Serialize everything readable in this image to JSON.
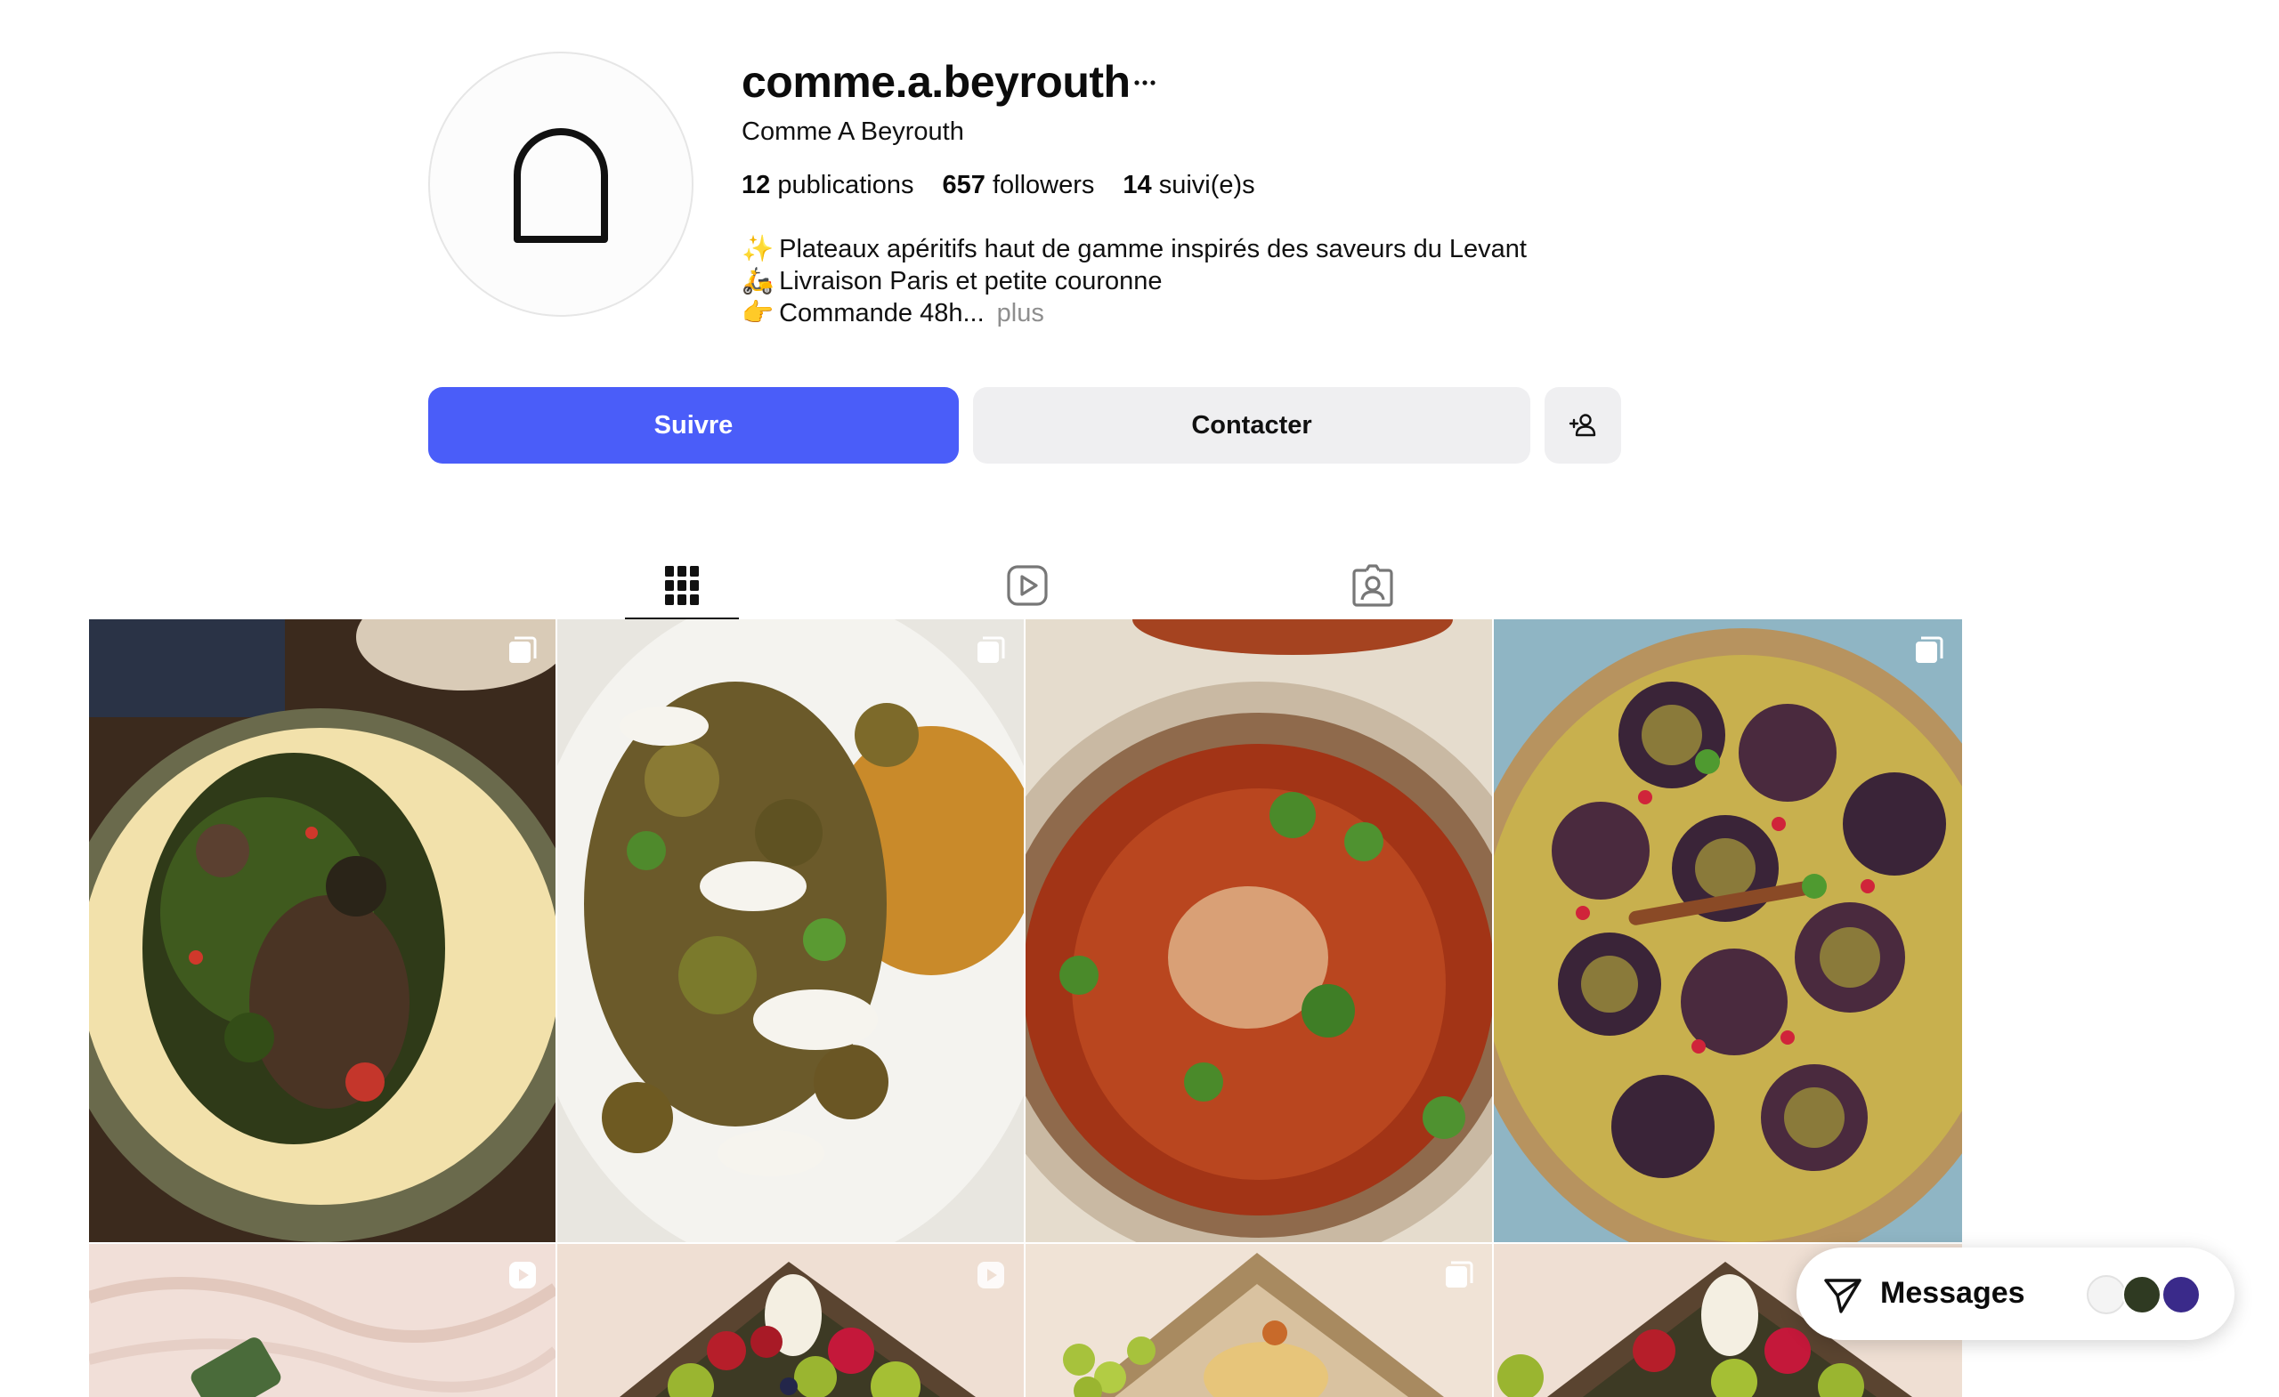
{
  "profile": {
    "username": "comme.a.beyrouth",
    "full_name": "Comme A Beyrouth",
    "stats": [
      {
        "count": "12",
        "label": "publications"
      },
      {
        "count": "657",
        "label": "followers"
      },
      {
        "count": "14",
        "label": "suivi(e)s"
      }
    ],
    "bio": [
      {
        "emoji": "✨",
        "text": "Plateaux apéritifs haut de gamme inspirés des saveurs du Levant"
      },
      {
        "emoji": "🛵",
        "text": "Livraison Paris et petite couronne"
      },
      {
        "emoji": "👉",
        "text": "Commande 48h...",
        "more": "plus"
      }
    ]
  },
  "actions": {
    "follow_label": "Suivre",
    "contact_label": "Contacter",
    "add_user_icon": "person-add-icon"
  },
  "tabs": [
    {
      "icon": "grid-icon",
      "active": true
    },
    {
      "icon": "reels-icon",
      "active": false
    },
    {
      "icon": "tagged-icon",
      "active": false
    }
  ],
  "posts": [
    {
      "subject": "mashed potatoes with herbed mushrooms",
      "badge": "carousel-icon"
    },
    {
      "subject": "roasted brussels sprouts with yogurt and herbs",
      "badge": "carousel-icon"
    },
    {
      "subject": "red lentil and tomato soup",
      "badge": "none"
    },
    {
      "subject": "eggplant with pomegranate over rice",
      "badge": "carousel-icon"
    },
    {
      "subject": "green asparagus platter",
      "badge": "reel-icon"
    },
    {
      "subject": "levantine aperitif platter",
      "badge": "reel-icon"
    },
    {
      "subject": "hummus and grapes platter",
      "badge": "carousel-icon"
    },
    {
      "subject": "levantine aperitif platter",
      "badge": "none"
    }
  ],
  "messages": {
    "label": "Messages",
    "icon": "send-icon"
  },
  "colors": {
    "accent": "#4a5df9",
    "secondary_button": "#efeff1",
    "muted_text": "#8e8e8e"
  }
}
